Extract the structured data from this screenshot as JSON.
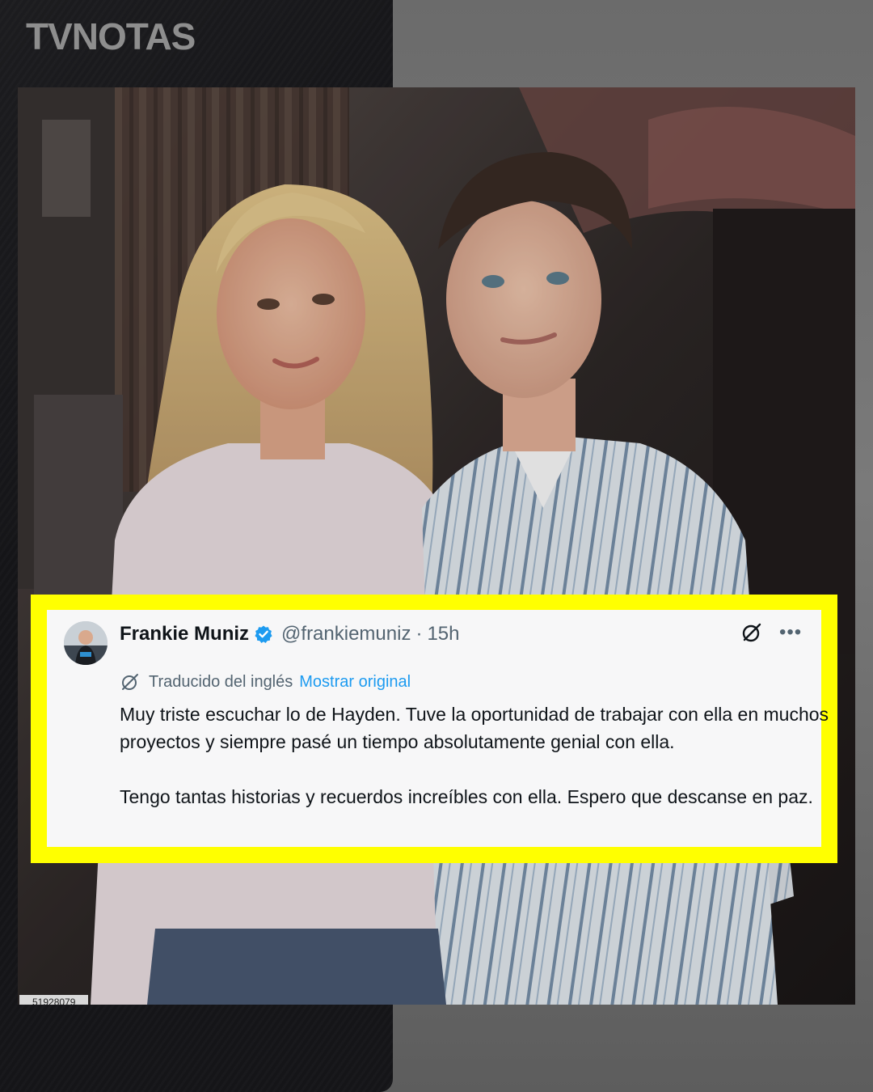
{
  "brand": {
    "logo_text": "TVNOTAS"
  },
  "photo": {
    "id_label": "51928079"
  },
  "tweet": {
    "author_name": "Frankie Muniz",
    "handle": "@frankiemuniz",
    "separator": "·",
    "time": "15h",
    "more_label": "•••",
    "translation_label": "Traducido del inglés",
    "show_original_label": "Mostrar original",
    "paragraphs": [
      "Muy triste escuchar lo de Hayden. Tuve la oportunidad de trabajar con ella en muchos proyectos y siempre pasé un tiempo absolutamente genial con ella.",
      "Tengo tantas historias y recuerdos increíbles con ella. Espero que descanse en paz."
    ],
    "icons": {
      "verified": "verified-badge-icon",
      "grok": "grok-icon",
      "more": "more-options-icon",
      "translate": "translate-icon"
    },
    "colors": {
      "highlight_frame": "#ffff00",
      "verified_blue": "#1d9bf0",
      "link_blue": "#1d9bf0",
      "secondary_text": "#536471"
    }
  }
}
